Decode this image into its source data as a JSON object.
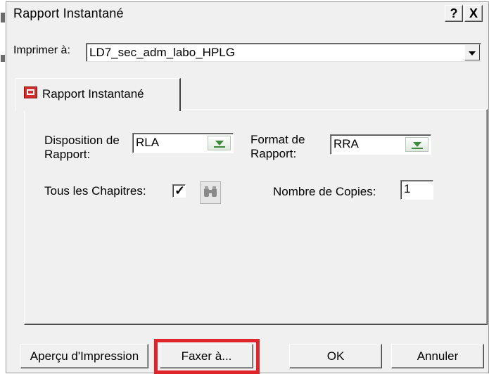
{
  "window": {
    "title": "Rapport Instantané",
    "help_label": "?",
    "close_label": "X"
  },
  "printer": {
    "label": "Imprimer à:",
    "value": "LD7_sec_adm_labo_HPLG"
  },
  "tab": {
    "label": "Rapport Instantané",
    "icon": "report-icon"
  },
  "layout_field": {
    "label_line1": "Disposition de",
    "label_line2": "Rapport:",
    "value": "RLA"
  },
  "format_field": {
    "label_line1": "Format de",
    "label_line2": "Rapport:",
    "value": "RRA"
  },
  "chapters": {
    "label": "Tous les Chapitres:",
    "checked": true,
    "check_glyph": "✓",
    "select_icon": "binoculars-icon"
  },
  "copies": {
    "label": "Nombre de Copies:",
    "value": "1"
  },
  "buttons": {
    "preview": "Aperçu d'Impression",
    "fax": "Faxer à...",
    "ok": "OK",
    "cancel": "Annuler"
  },
  "colors": {
    "highlight": "#e0252a",
    "dialog_bg": "#f0f0f0"
  }
}
